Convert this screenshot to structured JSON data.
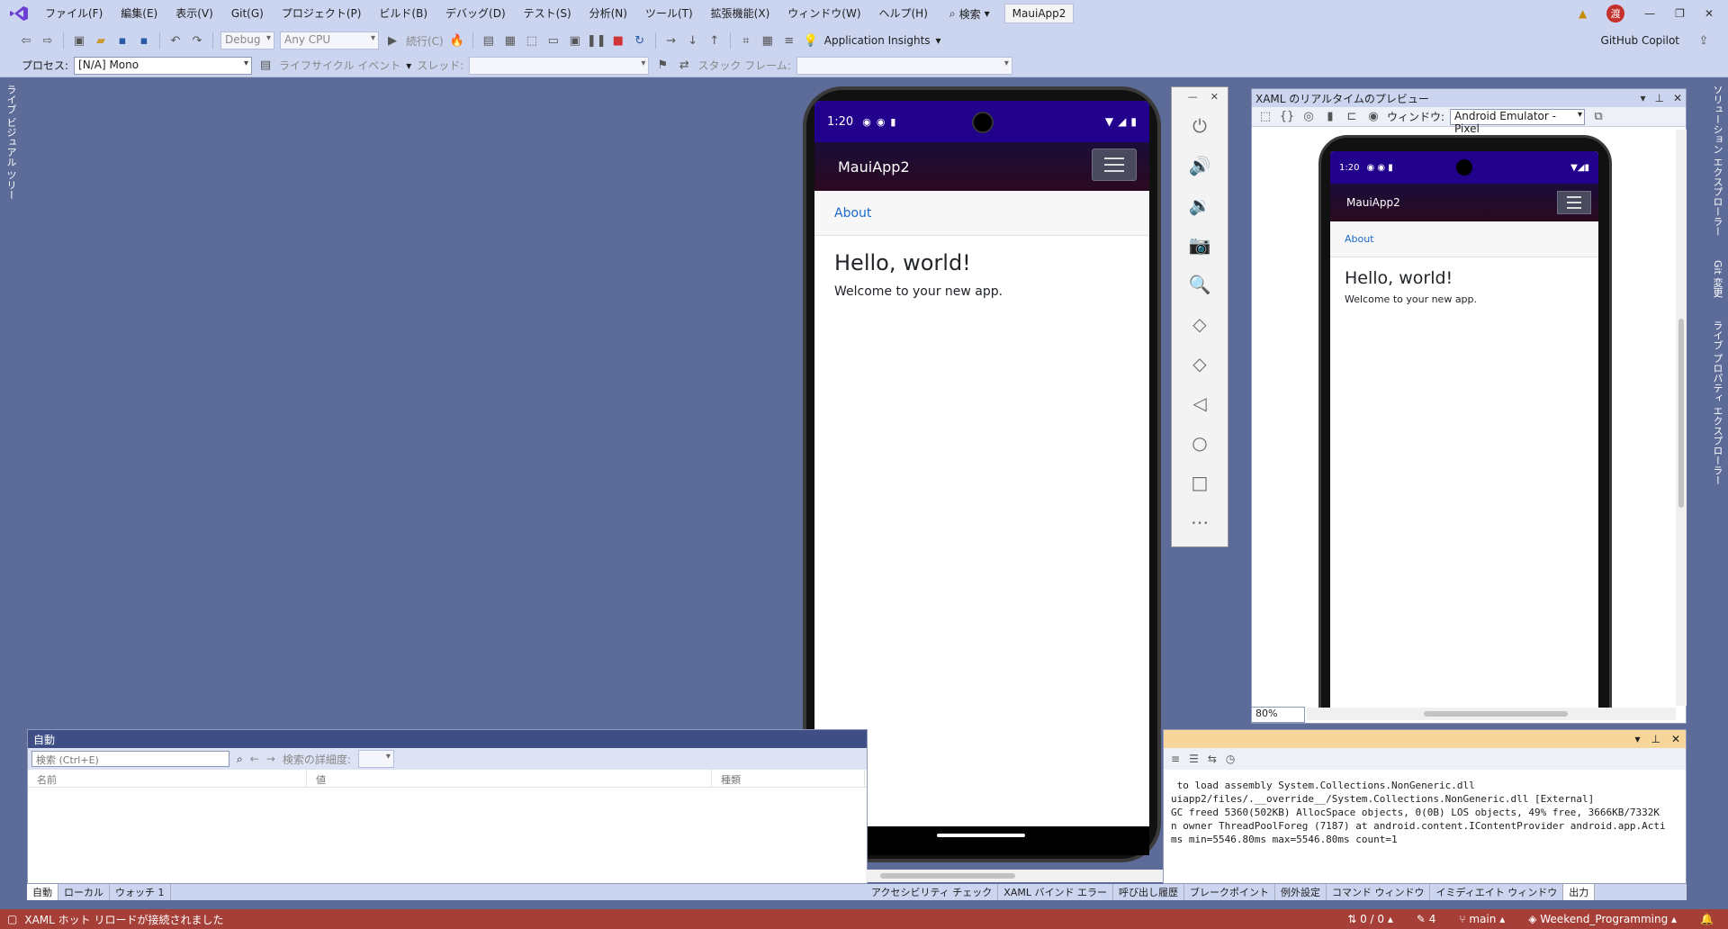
{
  "menubar": {
    "items": [
      "ファイル(F)",
      "編集(E)",
      "表示(V)",
      "Git(G)",
      "プロジェクト(P)",
      "ビルド(B)",
      "デバッグ(D)",
      "テスト(S)",
      "分析(N)",
      "ツール(T)",
      "拡張機能(X)",
      "ウィンドウ(W)",
      "ヘルプ(H)"
    ],
    "search_label": "検索",
    "solution_name": "MauiApp2",
    "avatar_initial": "渡"
  },
  "toolbar": {
    "config": "Debug",
    "platform": "Any CPU",
    "continue_label": "続行(C)",
    "app_insights": "Application Insights",
    "copilot": "GitHub Copilot"
  },
  "procbar": {
    "process_label": "プロセス:",
    "process_value": "[N/A] Mono",
    "lifecycle_label": "ライフサイクル イベント",
    "thread_label": "スレッド:",
    "stack_label": "スタック フレーム:"
  },
  "left_vtab": "ライブ ビジュアル ツリー",
  "right_vtabs": [
    "ソリューション エクスプローラー",
    "Git 変更",
    "ライブ プロパティ エクスプローラー"
  ],
  "phone": {
    "time": "1:20",
    "app_title": "MauiApp2",
    "about_link": "About",
    "heading": "Hello, world!",
    "body": "Welcome to your new app."
  },
  "emulator_tools": [
    "power-icon",
    "volume-up-icon",
    "volume-down-icon",
    "camera-icon",
    "zoom-icon",
    "rotate-left-icon",
    "rotate-right-icon",
    "back-icon",
    "home-icon",
    "overview-icon",
    "more-icon"
  ],
  "xaml_preview": {
    "title": "XAML のリアルタイムのプレビュー",
    "window_label": "ウィンドウ:",
    "window_value": "Android Emulator - Pixel",
    "zoom": "80%"
  },
  "auto_panel": {
    "title": "自動",
    "search_placeholder": "検索 (Ctrl+E)",
    "depth_label": "検索の詳細度:",
    "columns": [
      "名前",
      "値",
      "種類"
    ],
    "tabs": [
      "自動",
      "ローカル",
      "ウォッチ 1"
    ]
  },
  "output_panel": {
    "lines": [
      " to load assembly System.Collections.NonGeneric.dll",
      "uiapp2/files/.__override__/System.Collections.NonGeneric.dll [External]",
      "GC freed 5360(502KB) AllocSpace objects, 0(0B) LOS objects, 49% free, 3666KB/7332K",
      "n owner ThreadPoolForeg (7187) at android.content.IContentProvider android.app.Acti",
      "ms min=5546.80ms max=5546.80ms count=1"
    ],
    "tabs": [
      "アクセシビリティ チェック",
      "XAML バインド エラー",
      "呼び出し履歴",
      "ブレークポイント",
      "例外設定",
      "コマンド ウィンドウ",
      "イミディエイト ウィンドウ",
      "出力"
    ]
  },
  "statusbar": {
    "message": "XAML ホット リロードが接続されました",
    "changes": "0 / 0",
    "edits": "4",
    "branch": "main",
    "repo": "Weekend_Programming"
  }
}
